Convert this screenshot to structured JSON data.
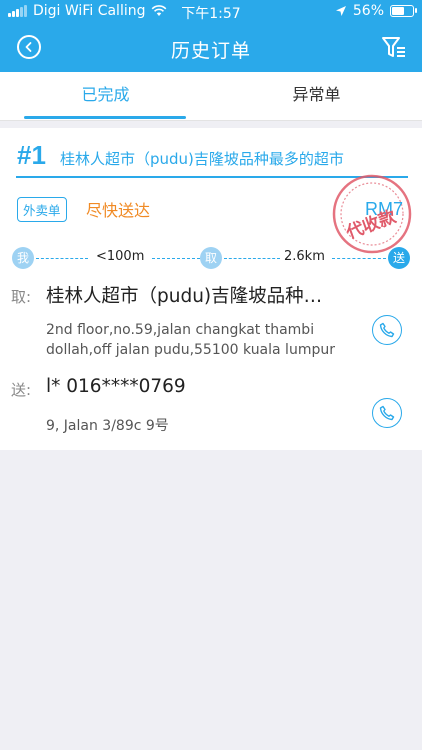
{
  "status_bar": {
    "carrier": "Digi WiFi Calling",
    "time": "下午1:57",
    "battery": "56%"
  },
  "nav": {
    "title": "历史订单"
  },
  "tabs": [
    {
      "label": "已完成",
      "active": true
    },
    {
      "label": "异常单",
      "active": false
    }
  ],
  "order": {
    "number": "#1",
    "shop_title": "桂林人超市（pudu)吉隆坡品种最多的超市",
    "tag": "外卖单",
    "urgency": "尽快送达",
    "stamp_amount": "RM7",
    "stamp_label": "代收款",
    "route": {
      "me_label": "我",
      "me_to_pickup": "<100m",
      "pickup_label": "取",
      "pickup_to_deliver": "2.6km",
      "deliver_label": "送"
    },
    "pickup": {
      "label": "取:",
      "name": "桂林人超市（pudu)吉隆坡品种…",
      "address": "2nd floor,no.59,jalan changkat thambi dollah,off jalan pudu,55100 kuala lumpur"
    },
    "delivery": {
      "label": "送:",
      "contact": "l*  016****0769",
      "address": "9, Jalan 3/89c 9号"
    }
  },
  "colors": {
    "primary": "#2aa9ea",
    "accent_orange": "#f08a24",
    "stamp_red": "#e05a6a",
    "background": "#efeff4"
  },
  "icons": {
    "back": "back-circle-icon",
    "filter": "filter-icon",
    "phone": "phone-icon",
    "wifi": "wifi-icon",
    "location": "location-arrow-icon"
  }
}
